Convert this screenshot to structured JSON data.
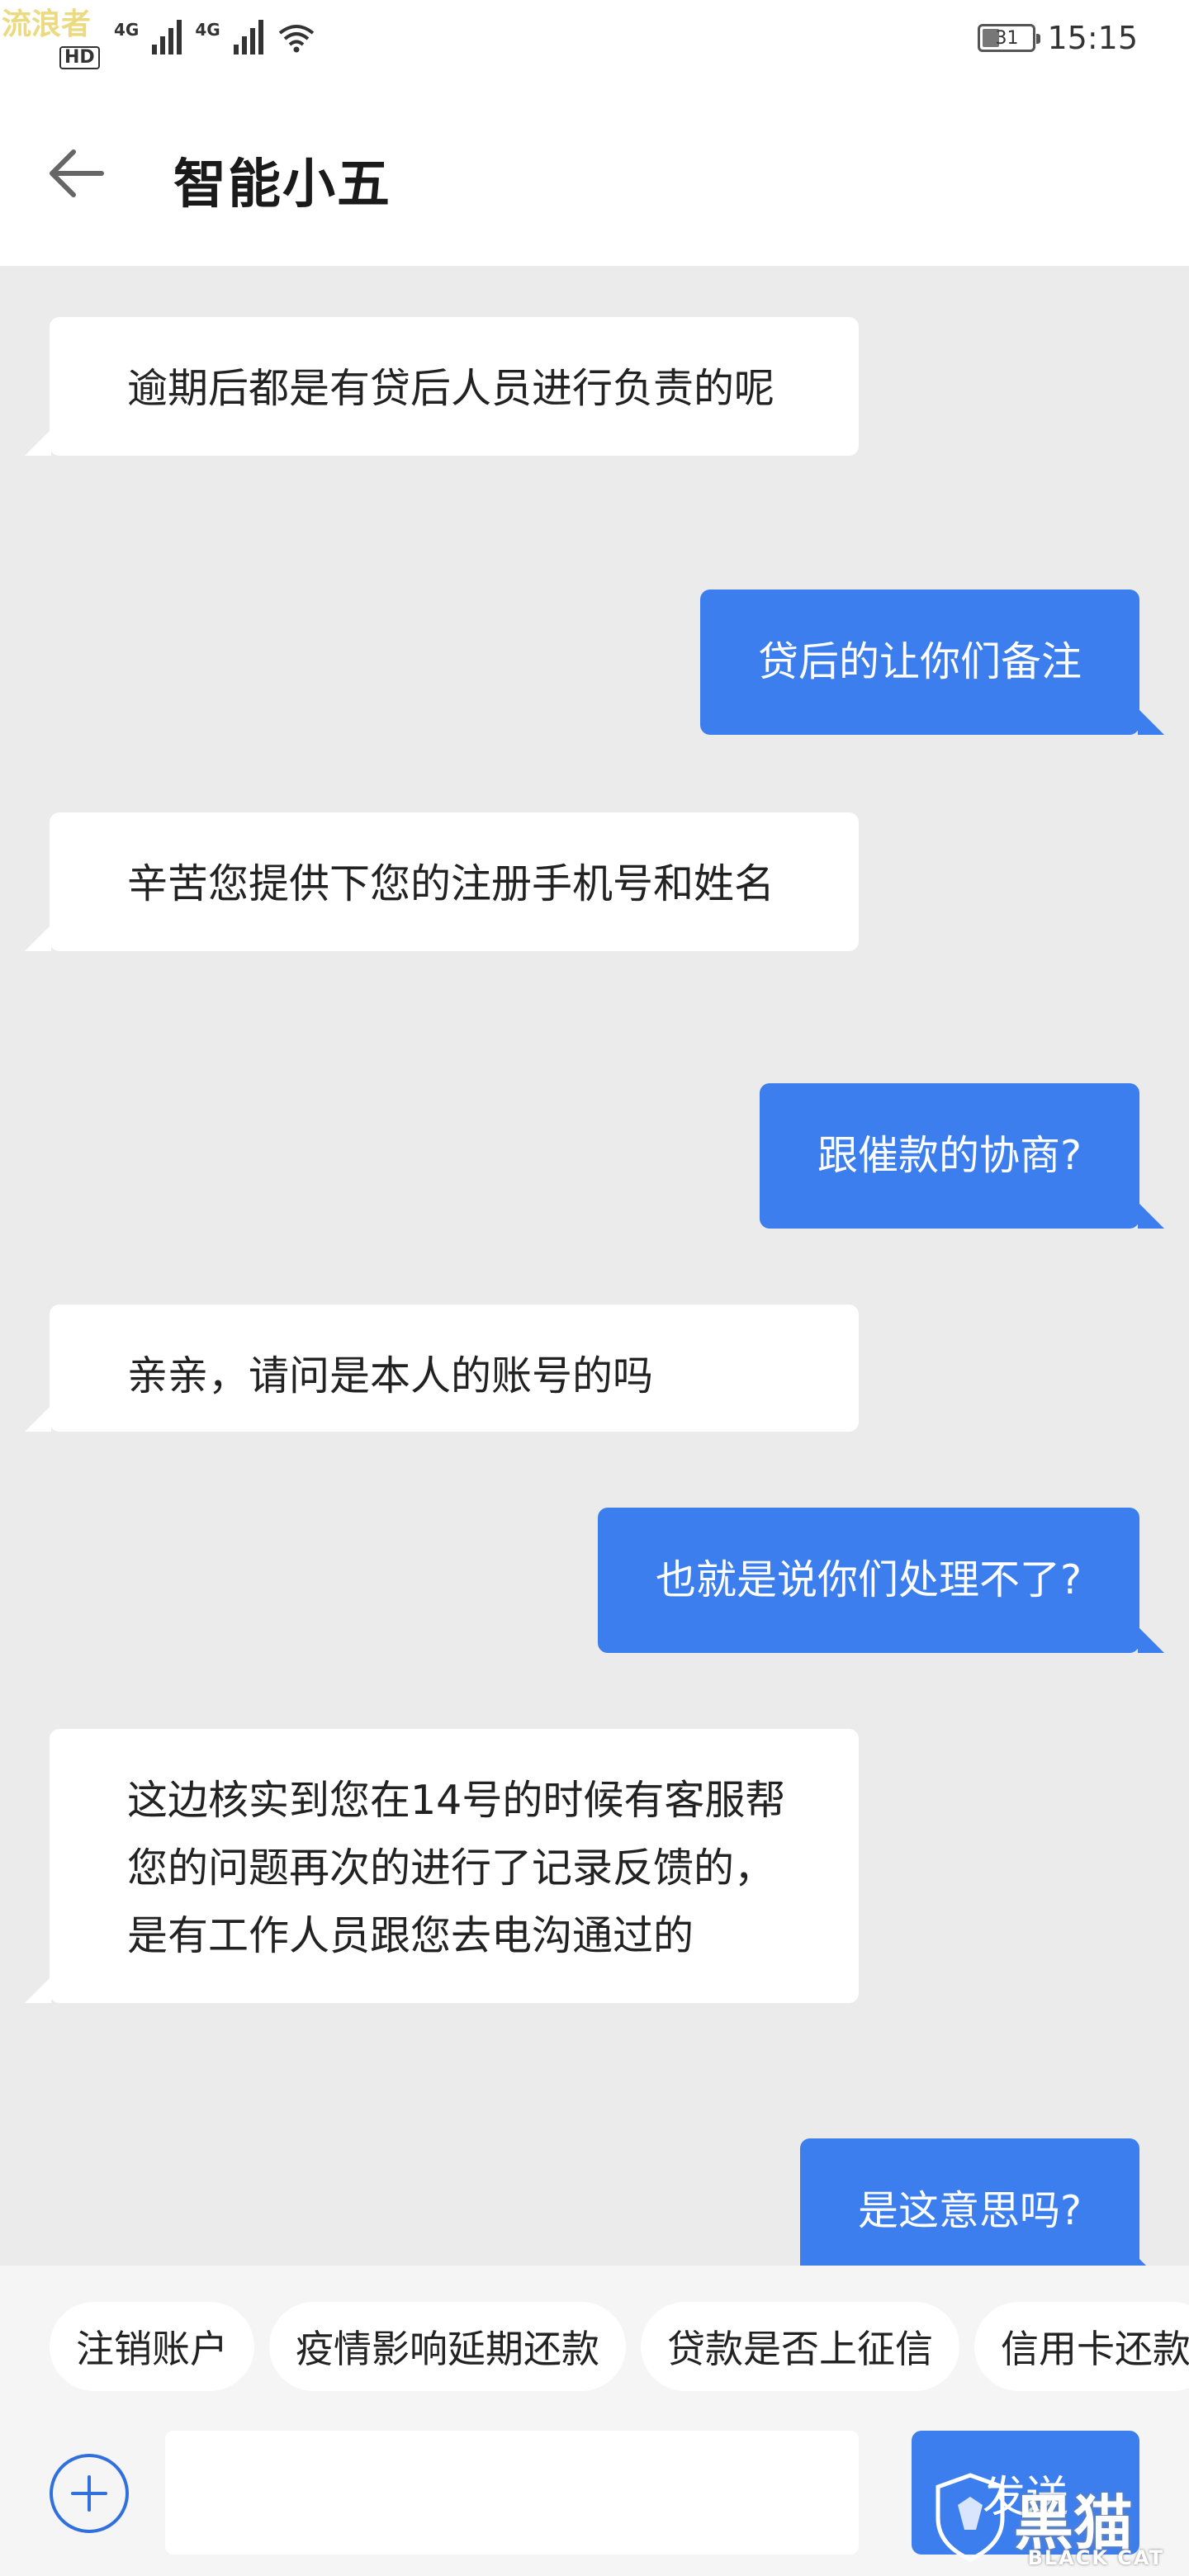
{
  "status_bar": {
    "time": "15:15",
    "battery": "31",
    "network_1": "4G",
    "network_2": "4G",
    "hd": "HD",
    "watermark": "流浪者"
  },
  "header": {
    "title": "智能小五"
  },
  "messages": [
    {
      "side": "left",
      "text": "逾期后都是有贷后人员进行负责的呢"
    },
    {
      "side": "right",
      "text": "贷后的让你们备注"
    },
    {
      "side": "left",
      "text": "辛苦您提供下您的注册手机号和姓名"
    },
    {
      "side": "right",
      "text": "跟催款的协商?"
    },
    {
      "side": "left",
      "text": "亲亲，请问是本人的账号的吗"
    },
    {
      "side": "right",
      "text": "也就是说你们处理不了?"
    },
    {
      "side": "left",
      "text": "这边核实到您在14号的时候有客服帮您的问题再次的进行了记录反馈的，是有工作人员跟您去电沟通过的"
    },
    {
      "side": "right",
      "text": "是这意思吗?"
    }
  ],
  "quick_replies": [
    "注销账户",
    "疫情影响延期还款",
    "贷款是否上征信",
    "信用卡还款"
  ],
  "input": {
    "value": "",
    "placeholder": "",
    "send_label": "发送"
  },
  "watermark_logo": {
    "text": "黑猫",
    "subtext": "BLACK CAT"
  },
  "colors": {
    "accent": "#3d7eee",
    "chat_bg": "#ebebeb",
    "bubble_left": "#ffffff"
  }
}
